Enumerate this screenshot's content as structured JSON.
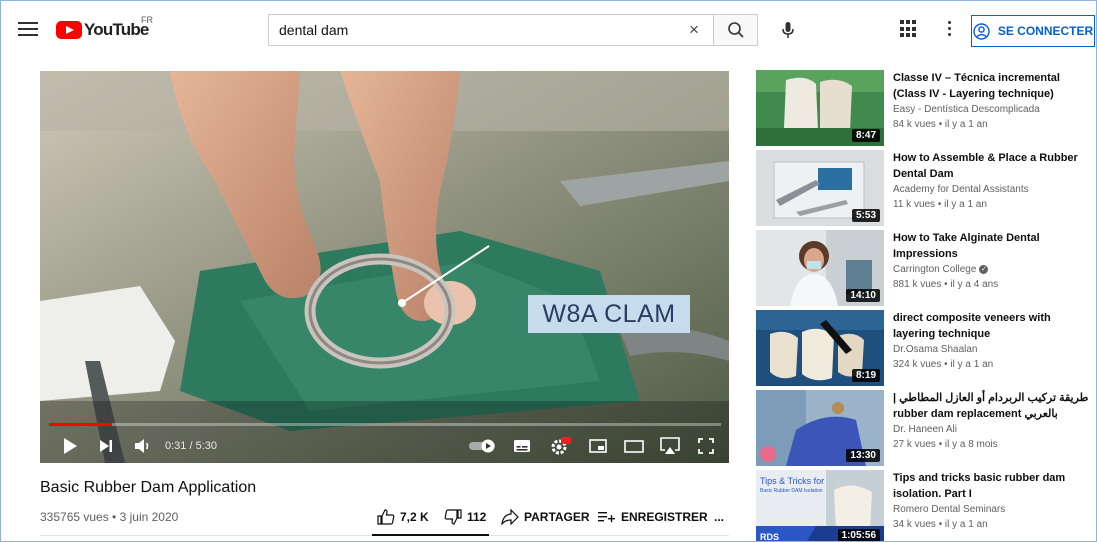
{
  "header": {
    "logo_text": "YouTube",
    "region": "FR",
    "search_value": "dental dam",
    "clear_glyph": "×",
    "signin_label": "SE CONNECTER"
  },
  "player": {
    "overlay_label": "W8A CLAM",
    "current_time": "0:31",
    "duration": "5:30",
    "progress_fraction": 0.094
  },
  "video": {
    "title": "Basic Rubber Dam Application",
    "meta": "335765 vues • 3 juin 2020",
    "likes": "7,2 K",
    "dislikes": "112",
    "share_label": "PARTAGER",
    "save_label": "ENREGISTRER",
    "more_label": "..."
  },
  "recommendations": [
    {
      "title": "Classe IV – Técnica incremental (Class IV - Layering technique)",
      "channel": "Easy - Dentística Descomplicada",
      "stats": "84 k vues • il y a 1 an",
      "duration": "8:47",
      "verified": false
    },
    {
      "title": "How to Assemble & Place a Rubber Dental Dam",
      "channel": "Academy for Dental Assistants",
      "stats": "11 k vues • il y a 1 an",
      "duration": "5:53",
      "verified": false
    },
    {
      "title": "How to Take Alginate Dental Impressions",
      "channel": "Carrington College",
      "stats": "881 k vues • il y a 4 ans",
      "duration": "14:10",
      "verified": true
    },
    {
      "title": "direct composite veneers with layering technique",
      "channel": "Dr.Osama Shaalan",
      "stats": "324 k vues • il y a 1 an",
      "duration": "8:19",
      "verified": false
    },
    {
      "title": "| طريقة تركيب الربردام أو العازل المطاطي rubber dam replacement بالعربي",
      "channel": "Dr. Haneen Ali",
      "stats": "27 k vues • il y a 8 mois",
      "duration": "13:30",
      "verified": false
    },
    {
      "title": "Tips and tricks basic rubber dam isolation. Part I",
      "channel": "Romero Dental Seminars",
      "stats": "34 k vues • il y a 1 an",
      "duration": "1:05:56",
      "verified": false
    }
  ],
  "thumb_texts": {
    "tips_title": "Tips & Tricks for",
    "tips_sub": "Basic Rubber DAM Isolation",
    "rds": "RDS"
  },
  "colors": {
    "accent_blue": "#065fd4",
    "youtube_red": "#ff0000",
    "overlay_bg": "#c6dcec",
    "overlay_text": "#2a3e63"
  },
  "icons": [
    "menu-icon",
    "youtube-logo-icon",
    "clear-icon",
    "search-icon",
    "mic-icon",
    "apps-grid-icon",
    "more-vert-icon",
    "account-icon",
    "play-icon",
    "next-icon",
    "volume-icon",
    "autoplay-toggle-icon",
    "subtitles-icon",
    "settings-icon",
    "miniplayer-icon",
    "theater-icon",
    "airplay-icon",
    "fullscreen-icon",
    "like-icon",
    "dislike-icon",
    "share-icon",
    "save-playlist-icon"
  ]
}
